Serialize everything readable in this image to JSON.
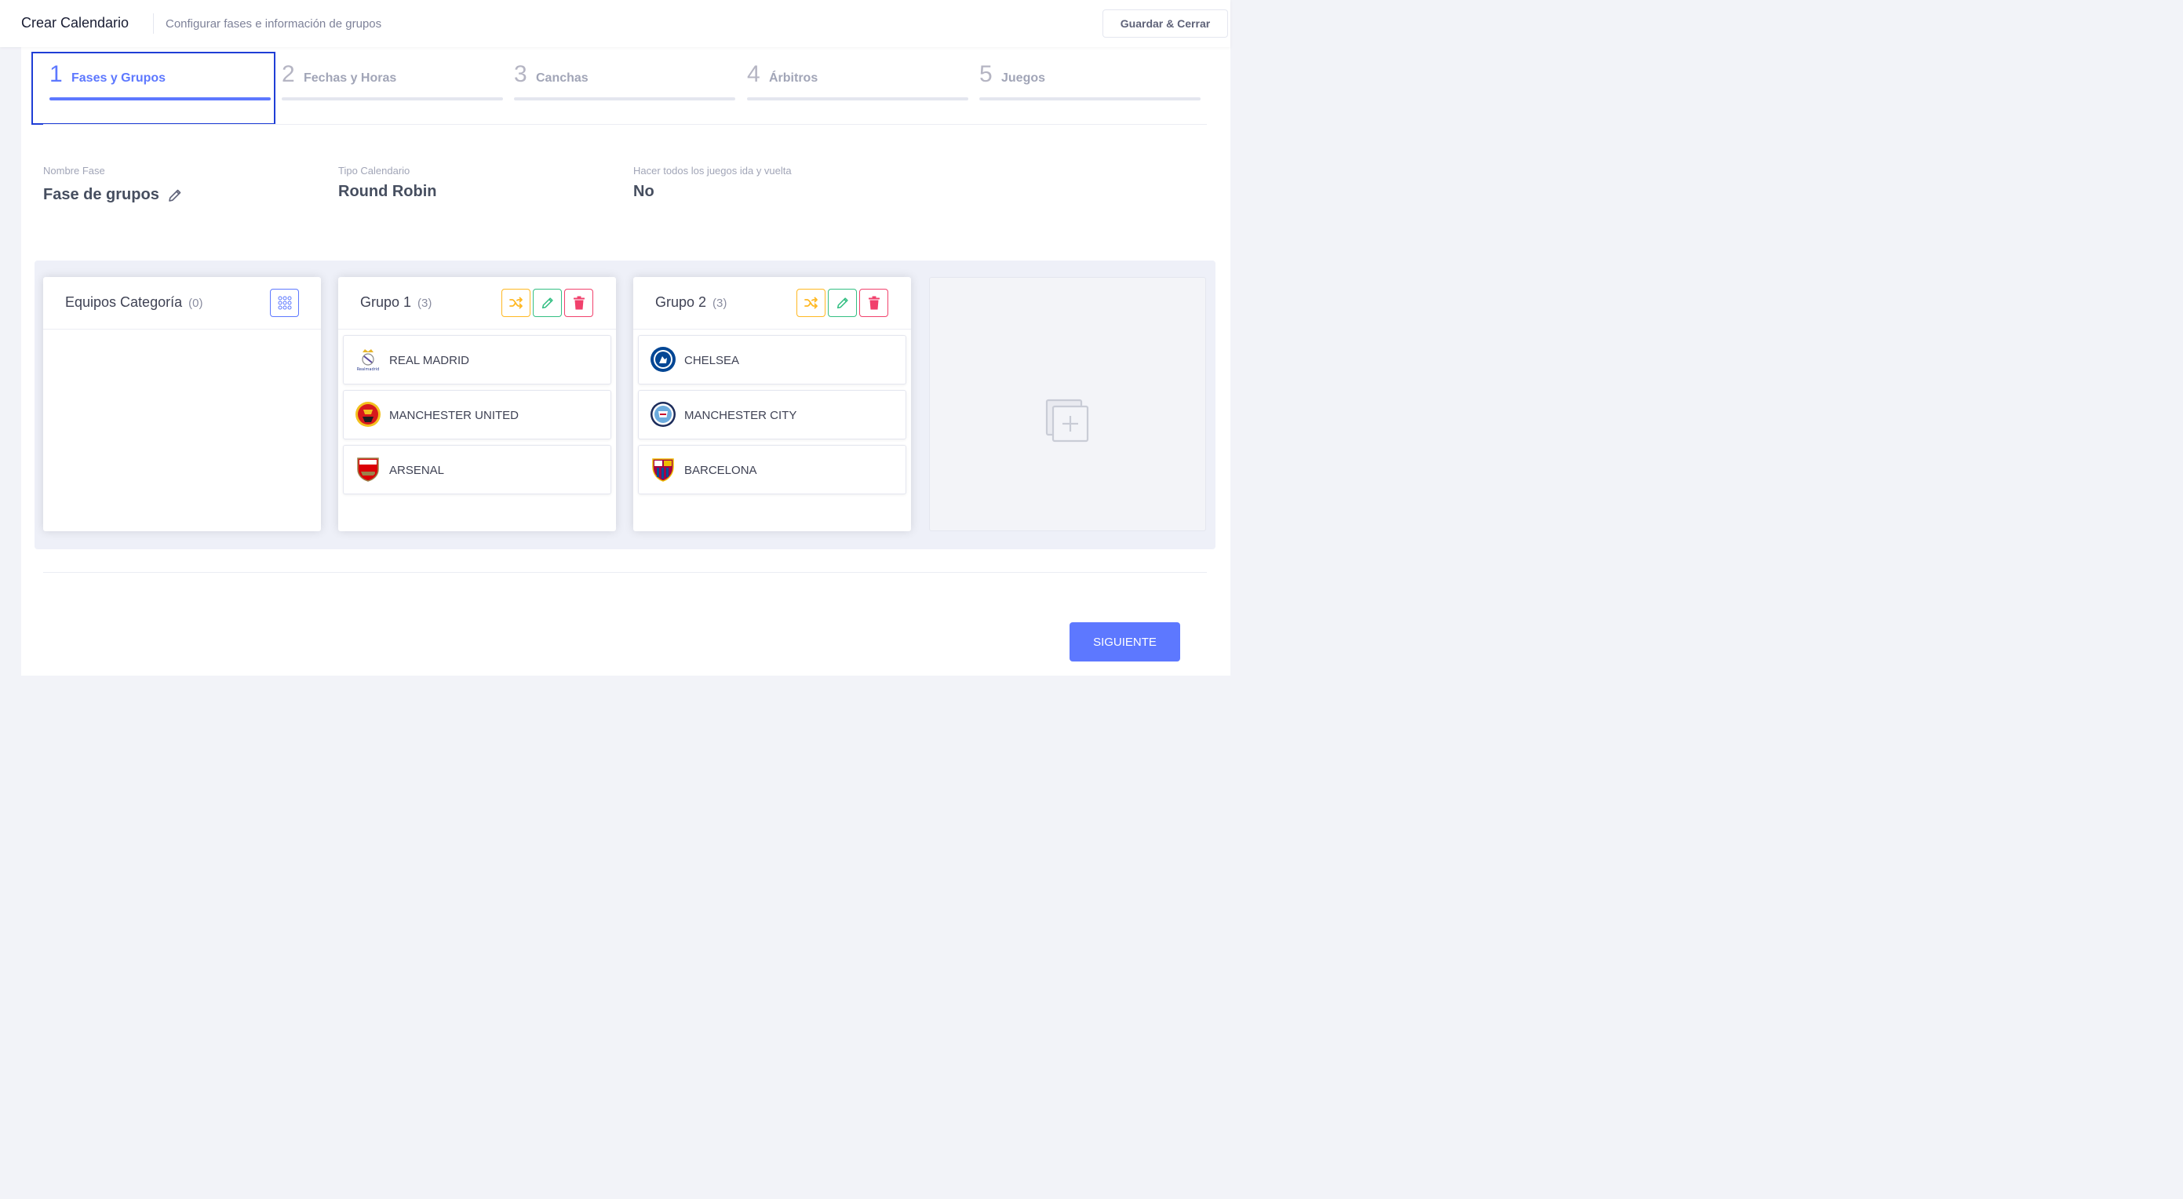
{
  "header": {
    "title": "Crear Calendario",
    "subtitle": "Configurar fases e información de grupos",
    "save_label": "Guardar & Cerrar"
  },
  "steps": [
    {
      "number": "1",
      "label": "Fases y Grupos",
      "active": true
    },
    {
      "number": "2",
      "label": "Fechas y Horas",
      "active": false
    },
    {
      "number": "3",
      "label": "Canchas",
      "active": false
    },
    {
      "number": "4",
      "label": "Árbitros",
      "active": false
    },
    {
      "number": "5",
      "label": "Juegos",
      "active": false
    }
  ],
  "phase": {
    "name_label": "Nombre Fase",
    "name_value": "Fase de grupos",
    "type_label": "Tipo Calendario",
    "type_value": "Round Robin",
    "roundtrip_label": "Hacer todos los juegos ida y vuelta",
    "roundtrip_value": "No"
  },
  "pool": {
    "name": "Equipos Categoría",
    "count": "(0)"
  },
  "groups": [
    {
      "name": "Grupo 1",
      "count": "(3)",
      "teams": [
        "REAL MADRID",
        "MANCHESTER UNITED",
        "ARSENAL"
      ]
    },
    {
      "name": "Grupo 2",
      "count": "(3)",
      "teams": [
        "CHELSEA",
        "MANCHESTER CITY",
        "BARCELONA"
      ]
    }
  ],
  "footer": {
    "next_label": "SIGUIENTE"
  },
  "colors": {
    "accent": "#5d78ff",
    "shuffle": "#ffb822",
    "edit": "#34bf83",
    "delete": "#f1416c",
    "focus_outline": "#1f3ed6"
  }
}
